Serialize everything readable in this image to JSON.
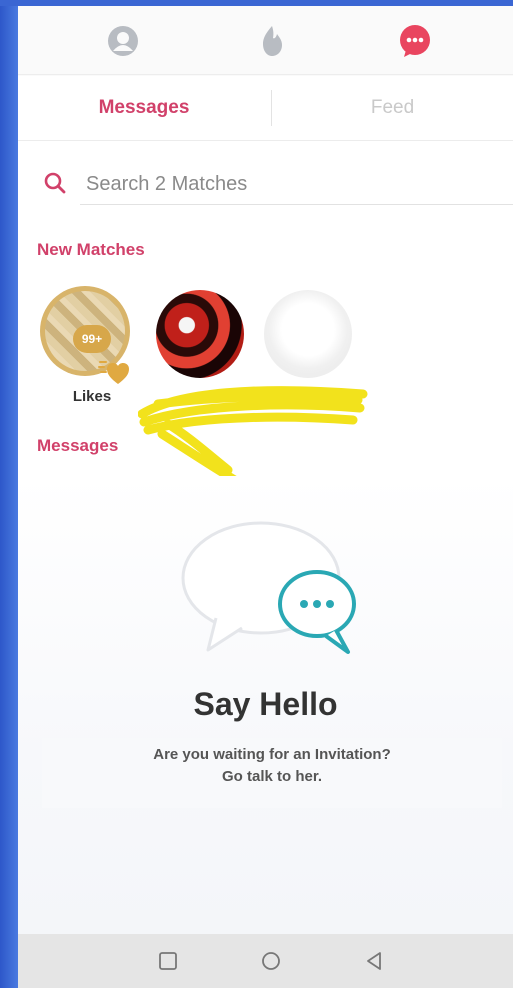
{
  "tabs": {
    "messages_label": "Messages",
    "feed_label": "Feed"
  },
  "search": {
    "placeholder": "Search 2 Matches"
  },
  "sections": {
    "new_matches_title": "New Matches",
    "messages_title": "Messages"
  },
  "likes": {
    "count": "99+",
    "label": "Likes"
  },
  "empty_state": {
    "title": "Say Hello",
    "line1": "Are you waiting for an Invitation?",
    "line2": "Go talk to her."
  },
  "colors": {
    "accent": "#d1416a",
    "gold": "#d7a74a",
    "teal": "#2aa8b4"
  },
  "icons": {
    "profile": "profile-icon",
    "flame": "flame-icon",
    "chat": "chat-icon",
    "search": "search-icon",
    "heart": "heart-icon",
    "recent": "recent-apps-icon",
    "home": "home-icon",
    "back": "back-icon"
  }
}
